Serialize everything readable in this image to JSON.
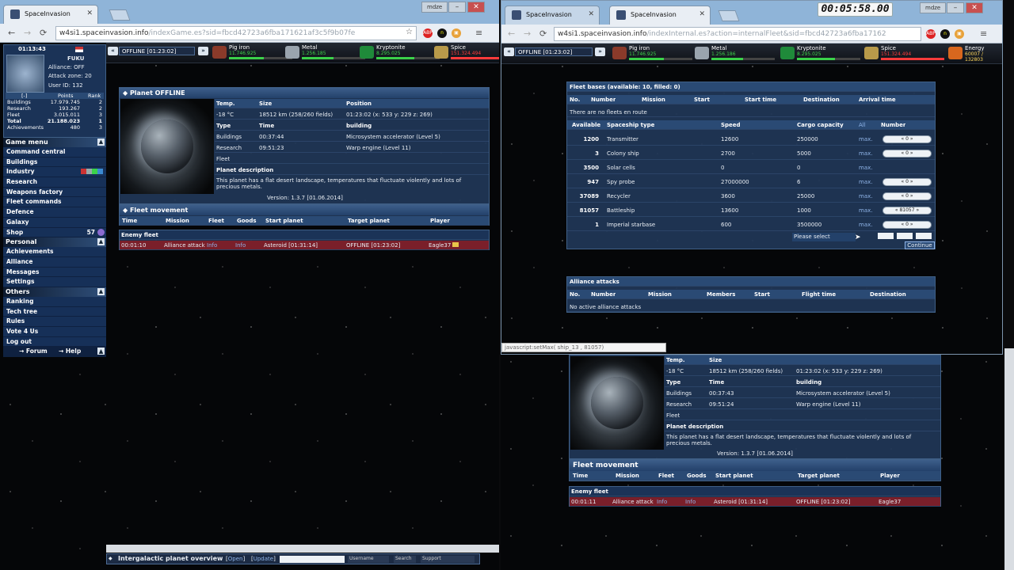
{
  "timer": "00:05:58.00",
  "left_window": {
    "tab_title": "SpaceInvasion",
    "user_chip": "mdze",
    "url_host": "w4si1.spaceinvasion.info",
    "url_path": "/indexGame.es?sid=fbcd42723a6fba171621af3c5f9b07fe",
    "location": "OFFLINE [01:23:02]",
    "resources": [
      {
        "name": "Pig iron",
        "value": "11.746.925",
        "color": "#3bd24a",
        "fill": 0.55
      },
      {
        "name": "Metal",
        "value": "1.256.185",
        "color": "#3bd24a",
        "fill": 0.5
      },
      {
        "name": "Kryptonite",
        "value": "8.295.025",
        "color": "#3bd24a",
        "fill": 0.6
      },
      {
        "name": "Spice",
        "value": "151.324.494",
        "color": "#ff3b3b",
        "fill": 1.0
      }
    ],
    "sidebar": {
      "clock": "01:13:43",
      "player": "FUKU",
      "alliance": "Alliance: OFF",
      "attack_zone": "Attack zone: 20",
      "user_id": "User ID: 132",
      "stats_headers": [
        "[-]",
        "Points",
        "Rank"
      ],
      "stats": [
        {
          "label": "Buildings",
          "points": "17.979.745",
          "rank": "2"
        },
        {
          "label": "Research",
          "points": "193.267",
          "rank": "2"
        },
        {
          "label": "Fleet",
          "points": "3.015.011",
          "rank": "3"
        },
        {
          "label": "Total",
          "points": "21.188.023",
          "rank": "1"
        },
        {
          "label": "Achievements",
          "points": "480",
          "rank": "3"
        }
      ],
      "game_menu": "Game menu",
      "game_items": [
        "Command central",
        "Buildings",
        "Industry",
        "Research",
        "Weapons factory",
        "Fleet commands",
        "Defence",
        "Galaxy",
        "Shop"
      ],
      "shop_count": "57",
      "personal": "Personal",
      "personal_items": [
        "Achievements",
        "Alliance",
        "Messages",
        "Settings"
      ],
      "others": "Others",
      "others_items": [
        "Ranking",
        "Tech tree",
        "Rules",
        "Vote 4 Us",
        "Log out"
      ],
      "forum": "Forum",
      "help": "Help"
    },
    "planet": {
      "title": "Planet OFFLINE",
      "headers": [
        "Temp.",
        "Size",
        "Position"
      ],
      "temp": "-18 °C",
      "size": "18512 km (258/260 fields)",
      "position": "01:23:02 (x: 533 y: 229 z: 269)",
      "type_label": "Type",
      "time_label": "Time",
      "building_label": "building",
      "buildings_label": "Buildings",
      "buildings_time": "00:37:44",
      "buildings_item": "Microsystem accelerator (Level 5)",
      "research_label": "Research",
      "research_time": "09:51:23",
      "research_item": "Warp engine (Level 11)",
      "fleet_label": "Fleet",
      "desc_label": "Planet description",
      "desc": "This planet has a flat desert landscape, temperatures that fluctuate violently and lots of precious metals.",
      "version": "Version: 1.3.7 [01.06.2014]"
    },
    "fleet_movement": {
      "title": "Fleet movement",
      "headers": [
        "Time",
        "Mission",
        "Fleet",
        "Goods",
        "Start planet",
        "Target planet",
        "Player"
      ],
      "enemy_label": "Enemy fleet",
      "row": {
        "time": "00:01:10",
        "mission": "Alliance attack",
        "fleet": "Info",
        "goods": "Info",
        "start": "Asteroid [01:31:14]",
        "target": "OFFLINE [01:23:02]",
        "player": "Eagle37"
      }
    },
    "bottom_bar": {
      "title": "Intergalactic planet overview",
      "open": "Open",
      "update": "Update",
      "username": "Username",
      "search": "Search",
      "support": "Support"
    }
  },
  "right_window": {
    "tab1": "SpaceInvasion",
    "tab2": "SpaceInvasion",
    "user_chip": "mdze",
    "url_host": "w4si1.spaceinvasion.info",
    "url_path": "/indexInternal.es?action=internalFleet&sid=fbcd42723a6fba17162",
    "location": "OFFLINE [01:23:02]",
    "resources": [
      {
        "name": "Pig iron",
        "value": "11.746.925",
        "color": "#3bd24a",
        "fill": 0.55
      },
      {
        "name": "Metal",
        "value": "1.256.186",
        "color": "#3bd24a",
        "fill": 0.5
      },
      {
        "name": "Kryptonite",
        "value": "8.295.025",
        "color": "#3bd24a",
        "fill": 0.6
      },
      {
        "name": "Spice",
        "value": "151.324.494",
        "color": "#ff3b3b",
        "fill": 1.0
      }
    ],
    "energy": {
      "name": "Energy",
      "value": "60007 / 132803"
    },
    "fleet_bases": {
      "title": "Fleet bases (available: 10, filled: 0)",
      "route_headers": [
        "No.",
        "Number",
        "Mission",
        "Start",
        "Start time",
        "Destination",
        "Arrival time"
      ],
      "no_fleets": "There are no fleets en route",
      "ship_headers": [
        "Available",
        "Spaceship type",
        "Speed",
        "Cargo capacity",
        "All",
        "Number"
      ],
      "max_label": "max.",
      "ships": [
        {
          "available": "1200",
          "type": "Transmitter",
          "speed": "12600",
          "cargo": "250000",
          "number": "0"
        },
        {
          "available": "3",
          "type": "Colony ship",
          "speed": "2700",
          "cargo": "5000",
          "number": "0"
        },
        {
          "available": "3500",
          "type": "Solar cells",
          "speed": "0",
          "cargo": "0",
          "number": ""
        },
        {
          "available": "947",
          "type": "Spy probe",
          "speed": "27000000",
          "cargo": "6",
          "number": "0"
        },
        {
          "available": "37089",
          "type": "Recycler",
          "speed": "3600",
          "cargo": "25000",
          "number": "0"
        },
        {
          "available": "81057",
          "type": "Battleship",
          "speed": "13600",
          "cargo": "1000",
          "number": "81057"
        },
        {
          "available": "1",
          "type": "Imperial starbase",
          "speed": "600",
          "cargo": "3500000",
          "number": "0"
        }
      ],
      "please_select": "Please select",
      "continue": "Continue"
    },
    "alliance_attacks": {
      "title": "Alliance attacks",
      "headers": [
        "No.",
        "Number",
        "Mission",
        "Members",
        "Start",
        "Flight time",
        "Destination"
      ],
      "empty": "No active alliance attacks"
    },
    "status_url": "javascript:setMax( ship_13 , 81057)"
  },
  "background_window": {
    "headers": [
      "Temp.",
      "Size"
    ],
    "temp": "-18 °C",
    "size": "18512 km (258/260 fields)",
    "position": "01:23:02 (x: 533 y: 229 z: 269)",
    "type_label": "Type",
    "time_label": "Time",
    "building_label": "building",
    "buildings_label": "Buildings",
    "buildings_time": "00:37:43",
    "buildings_item": "Microsystem accelerator (Level 5)",
    "research_label": "Research",
    "research_time": "09:51:24",
    "research_item": "Warp engine (Level 11)",
    "fleet_label": "Fleet",
    "desc_label": "Planet description",
    "desc": "This planet has a flat desert landscape, temperatures that fluctuate violently and lots of precious metals.",
    "version": "Version: 1.3.7 [01.06.2014]",
    "fleet_movement": {
      "title": "Fleet movement",
      "headers": [
        "Time",
        "Mission",
        "Fleet",
        "Goods",
        "Start planet",
        "Target planet",
        "Player"
      ],
      "enemy_label": "Enemy fleet",
      "row": {
        "time": "00:01:11",
        "mission": "Alliance attack",
        "fleet": "Info",
        "goods": "Info",
        "start": "Asteroid [01:31:14]",
        "target": "OFFLINE [01:23:02]",
        "player": "Eagle37"
      }
    }
  },
  "icons": {
    "back": "arrow-left-icon",
    "forward": "arrow-right-icon",
    "reload": "reload-icon",
    "star": "bookmark-star-icon",
    "menu": "hamburger-menu-icon"
  }
}
